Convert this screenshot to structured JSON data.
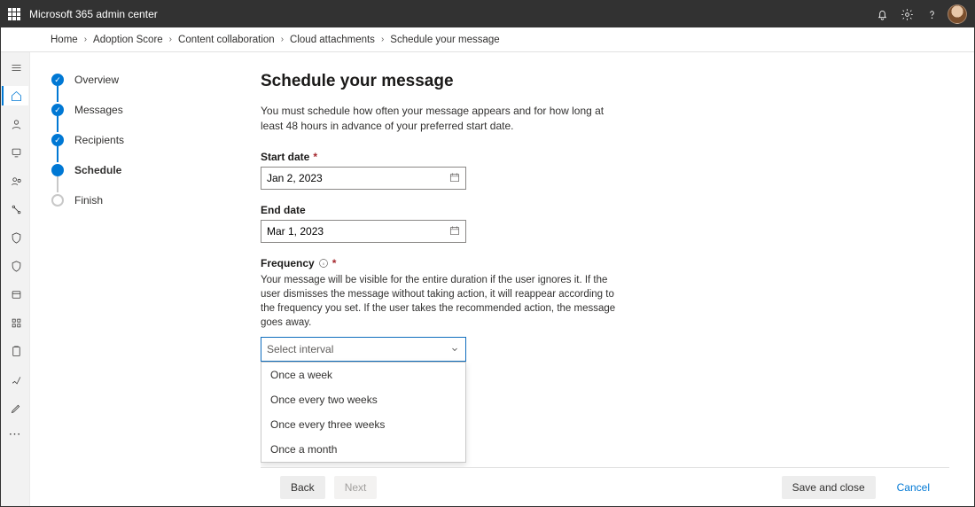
{
  "topbar": {
    "title": "Microsoft 365 admin center"
  },
  "breadcrumb": [
    "Home",
    "Adoption Score",
    "Content collaboration",
    "Cloud attachments",
    "Schedule your message"
  ],
  "rail_icons": [
    "home",
    "person",
    "devices",
    "group",
    "connector",
    "shield",
    "shield",
    "building",
    "apps",
    "clipboard",
    "wrench",
    "edit"
  ],
  "wizard": {
    "steps": [
      {
        "label": "Overview",
        "state": "done"
      },
      {
        "label": "Messages",
        "state": "done"
      },
      {
        "label": "Recipients",
        "state": "done"
      },
      {
        "label": "Schedule",
        "state": "current"
      },
      {
        "label": "Finish",
        "state": "upcoming"
      }
    ]
  },
  "page": {
    "heading": "Schedule your message",
    "lead": "You must schedule how often your message appears and for how long at least 48 hours in advance of your preferred start date.",
    "start_date_label": "Start date",
    "start_date_value": "Jan 2, 2023",
    "end_date_label": "End date",
    "end_date_value": "Mar 1, 2023",
    "frequency_label": "Frequency",
    "frequency_help": "Your message will be visible for the entire duration if the user ignores it. If the user dismisses the message without taking action, it will reappear according to the frequency you set. If the user takes the recommended action, the message goes away.",
    "frequency_placeholder": "Select interval",
    "frequency_options": [
      "Once a week",
      "Once every two weeks",
      "Once every three weeks",
      "Once a month"
    ]
  },
  "footer": {
    "back": "Back",
    "next": "Next",
    "save": "Save and close",
    "cancel": "Cancel"
  }
}
